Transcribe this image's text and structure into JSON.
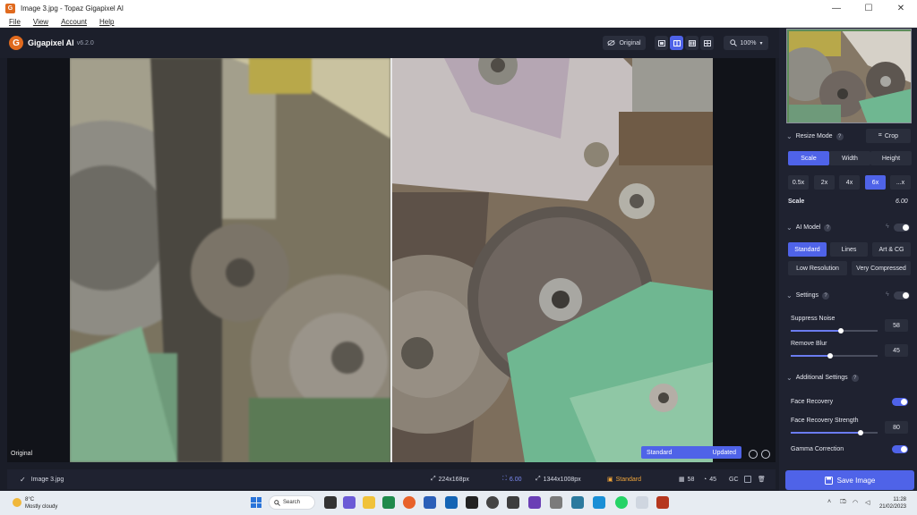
{
  "window": {
    "title": "Image 3.jpg - Topaz Gigapixel AI",
    "minimize": "—",
    "maximize": "☐",
    "close": "✕"
  },
  "menu": [
    "File",
    "View",
    "Account",
    "Help"
  ],
  "app": {
    "name": "Gigapixel AI",
    "version": "v6.2.0",
    "logo_letter": "G"
  },
  "toolbar": {
    "original_label": "Original",
    "zoom": "100%",
    "view_modes": [
      "single",
      "split",
      "side-by-side",
      "quad"
    ],
    "active_view_mode": "split"
  },
  "viewer": {
    "original_badge": "Original",
    "compare_left": "Standard",
    "compare_right": "Updated"
  },
  "status": {
    "filename": "Image 3.jpg",
    "input_size": "224x168px",
    "scale": "6.00",
    "output_size": "1344x1008px",
    "model": "Standard",
    "noise": "58",
    "blur": "45",
    "gc": "GC"
  },
  "panel": {
    "resize_mode": {
      "title": "Resize Mode",
      "crop_label": "Crop",
      "tabs": [
        "Scale",
        "Width",
        "Height"
      ],
      "active_tab": "Scale",
      "scale_options": [
        "0.5x",
        "2x",
        "4x",
        "6x",
        "...x"
      ],
      "active_scale": "6x",
      "scale_label": "Scale",
      "scale_value": "6.00"
    },
    "ai_model": {
      "title": "AI Model",
      "models_row1": [
        "Standard",
        "Lines",
        "Art & CG"
      ],
      "models_row2": [
        "Low Resolution",
        "Very Compressed"
      ],
      "active_model": "Standard",
      "toggle_on": false
    },
    "settings": {
      "title": "Settings",
      "toggle_on": false,
      "suppress_noise_label": "Suppress Noise",
      "suppress_noise_value": "58",
      "suppress_noise_level": 0.58,
      "remove_blur_label": "Remove Blur",
      "remove_blur_value": "45",
      "remove_blur_level": 0.45
    },
    "additional": {
      "title": "Additional Settings",
      "face_recovery_label": "Face Recovery",
      "face_recovery_on": true,
      "face_strength_label": "Face Recovery Strength",
      "face_strength_value": "80",
      "face_strength_level": 0.8,
      "gamma_label": "Gamma Correction",
      "gamma_on": true
    },
    "save_label": "Save Image"
  },
  "taskbar": {
    "temp": "8°C",
    "weather": "Mostly cloudy",
    "search": "Search",
    "time": "11:28",
    "date": "21/02/2023"
  },
  "colors": {
    "accent": "#4f63e8",
    "panel_bg": "#1f2230",
    "app_bg": "#1a1d28",
    "brand_orange": "#e06a1e"
  }
}
